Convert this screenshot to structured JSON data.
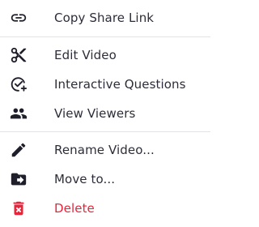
{
  "menu": {
    "items": [
      {
        "label": "Copy Share Link",
        "icon": "link-icon"
      },
      {
        "label": "Edit Video",
        "icon": "scissors-icon"
      },
      {
        "label": "Interactive Questions",
        "icon": "check-circle-plus-icon"
      },
      {
        "label": "View Viewers",
        "icon": "people-icon"
      },
      {
        "label": "Rename Video...",
        "icon": "pencil-icon"
      },
      {
        "label": "Move to...",
        "icon": "folder-move-icon"
      },
      {
        "label": "Delete",
        "icon": "trash-icon"
      }
    ]
  },
  "colors": {
    "text": "#2d2d3a",
    "icon": "#1f1f2b",
    "danger": "#e8243a",
    "divider": "#e4e4e8"
  }
}
